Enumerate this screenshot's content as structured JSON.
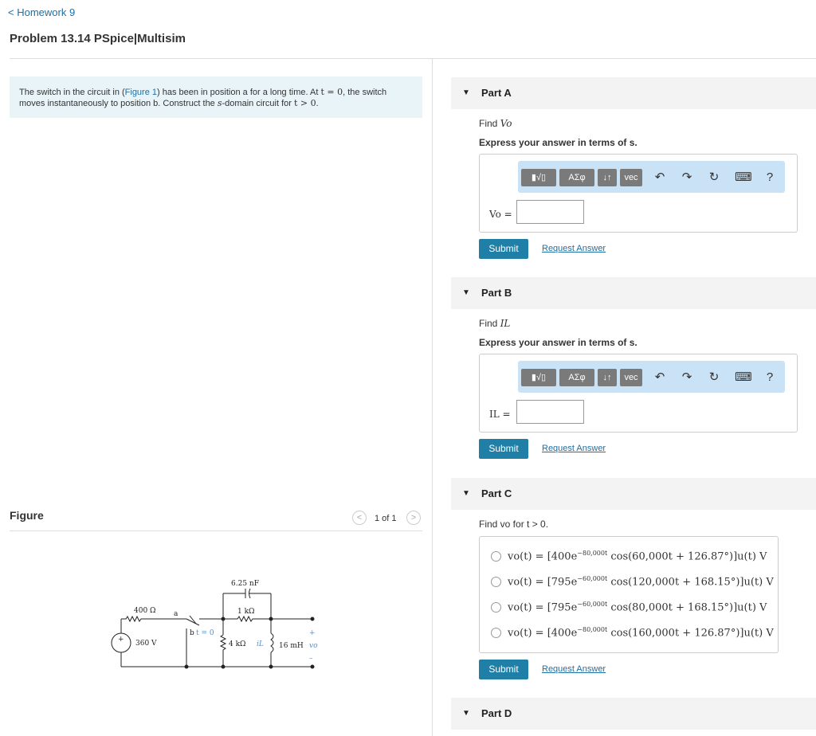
{
  "nav": {
    "back_label": "< Homework 9"
  },
  "problem": {
    "title": "Problem 13.14 PSpice|Multisim",
    "prompt_part1": "The switch in the circuit in (",
    "prompt_link": "Figure 1",
    "prompt_part2": ") has been in position a for a long time. At ",
    "prompt_math1": "t = 0",
    "prompt_part3": ", the switch",
    "prompt_line2a": "moves instantaneously to position b. Construct the ",
    "prompt_math2": "s",
    "prompt_line2b": "-domain circuit for ",
    "prompt_math3": "t > 0",
    "prompt_end": "."
  },
  "figure": {
    "label": "Figure",
    "pager_prev": "<",
    "pager_text": "1 of 1",
    "pager_next": ">",
    "circuit_labels": {
      "r1": "400 Ω",
      "node_a": "a",
      "node_b": "b",
      "switch_time": "t = 0",
      "cap": "6.25 nF",
      "r2": "1 kΩ",
      "r3": "4 kΩ",
      "il": "iL",
      "ind": "16 mH",
      "vo": "vo",
      "src": "360 V",
      "plus": "+",
      "minus": "–",
      "src_plus": "+"
    }
  },
  "toolbar": {
    "template_label": "▮√▯",
    "greek_label": "ΑΣφ",
    "sort_label": "↓↑",
    "vec_label": "vec",
    "undo_icon": "↶",
    "redo_icon": "↷",
    "reset_icon": "↻",
    "keyboard_icon": "⌨",
    "help_icon": "?"
  },
  "parts": {
    "a": {
      "name": "Part A",
      "find_prefix": "Find ",
      "find_var": "Vo",
      "express": "Express your answer in terms of s.",
      "var_label": "Vo =",
      "submit": "Submit",
      "request": "Request Answer"
    },
    "b": {
      "name": "Part B",
      "find_prefix": "Find ",
      "find_var": "IL",
      "express": "Express your answer in terms of s.",
      "var_label": "IL =",
      "submit": "Submit",
      "request": "Request Answer"
    },
    "c": {
      "name": "Part C",
      "find_text": "Find vo for t > 0.",
      "choices": [
        {
          "label": "vo(t) = [400e",
          "exp": "−80,000t",
          "rest": " cos(60,000t + 126.87°)]u(t) V"
        },
        {
          "label": "vo(t) = [795e",
          "exp": "−60,000t",
          "rest": " cos(120,000t + 168.15°)]u(t) V"
        },
        {
          "label": "vo(t) = [795e",
          "exp": "−60,000t",
          "rest": " cos(80,000t + 168.15°)]u(t) V"
        },
        {
          "label": "vo(t) = [400e",
          "exp": "−80,000t",
          "rest": " cos(160,000t + 126.87°)]u(t) V"
        }
      ],
      "submit": "Submit",
      "request": "Request Answer"
    },
    "d": {
      "name": "Part D"
    }
  },
  "colors": {
    "accent": "#1f7fa6",
    "link": "#1d6fa5",
    "prompt_bg": "#e9f4f9",
    "toolbar_bg": "#c9e2f5"
  }
}
